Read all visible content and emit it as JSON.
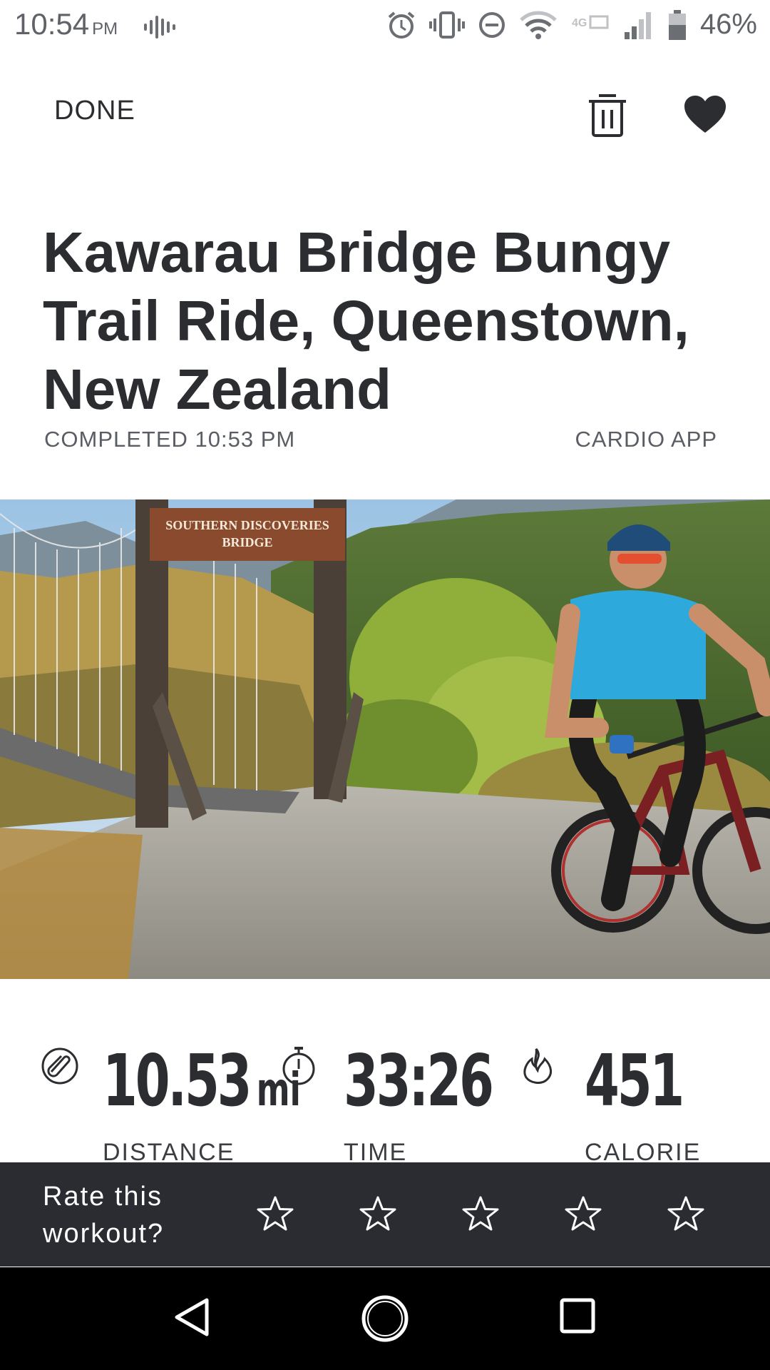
{
  "status_bar": {
    "time": "10:54",
    "ampm": "PM",
    "battery_percent": "46%",
    "icons": [
      "sound-wave-icon",
      "alarm-icon",
      "vibrate-icon",
      "do-not-disturb-icon",
      "wifi-icon",
      "4g-icon",
      "signal-icon",
      "battery-icon"
    ]
  },
  "header": {
    "done_label": "DONE",
    "trash_icon": "trash-icon",
    "favorite_icon": "heart-icon"
  },
  "workout": {
    "title": "Kawarau Bridge Bungy Trail Ride, Queenstown, New Zealand",
    "completed": "COMPLETED 10:53 PM",
    "source": "CARDIO APP",
    "image_sign_text": "SOUTHERN DISCOVERIES BRIDGE"
  },
  "stats": [
    {
      "icon": "distance-icon",
      "value": "10.53",
      "unit": "mi",
      "label": "DISTANCE"
    },
    {
      "icon": "stopwatch-icon",
      "value": "33:26",
      "unit": "",
      "label": "TIME"
    },
    {
      "icon": "flame-icon",
      "value": "451",
      "unit": "",
      "label": "CALORIE"
    }
  ],
  "rating": {
    "prompt": "Rate this workout?",
    "stars": 5,
    "selected": 0
  },
  "nav": {
    "back_icon": "back-triangle-icon",
    "home_icon": "home-circle-icon",
    "recents_icon": "recents-square-icon"
  },
  "colors": {
    "text": "#2b2d31",
    "rate_bar_bg": "#2a2c31",
    "nav_bg": "#000000"
  }
}
